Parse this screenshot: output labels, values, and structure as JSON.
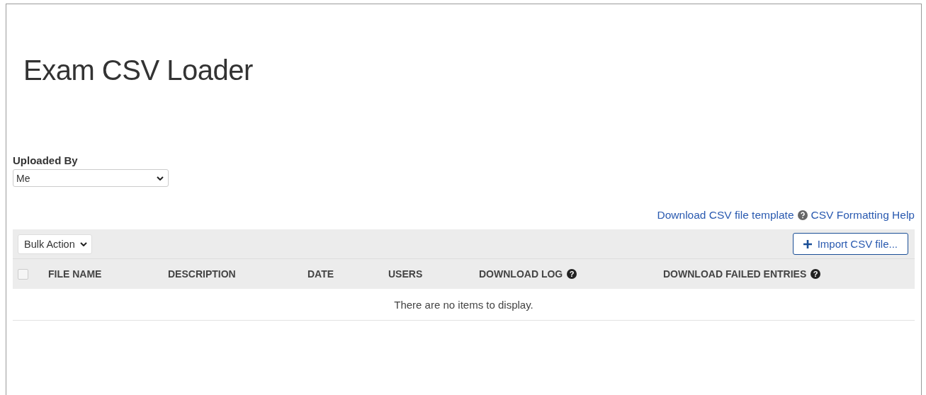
{
  "page": {
    "title": "Exam CSV Loader"
  },
  "filter": {
    "label": "Uploaded By",
    "value": "Me"
  },
  "links": [
    {
      "text": "Download CSV file template",
      "kind": "link"
    },
    {
      "text": "CSV Formatting Help",
      "kind": "help-link"
    }
  ],
  "toolbar": {
    "bulk_action": "Bulk Action",
    "import_button": "Import CSV file..."
  },
  "table": {
    "select_all": {
      "checked": false
    },
    "columns": [
      {
        "label": "FILE NAME"
      },
      {
        "label": "DESCRIPTION"
      },
      {
        "label": "DATE"
      },
      {
        "label": "USERS"
      },
      {
        "label": "DOWNLOAD LOG",
        "help_icon": "?"
      },
      {
        "label": "DOWNLOAD FAILED ENTRIES",
        "help_icon": "?"
      }
    ],
    "empty_message": "There are no items to display."
  }
}
